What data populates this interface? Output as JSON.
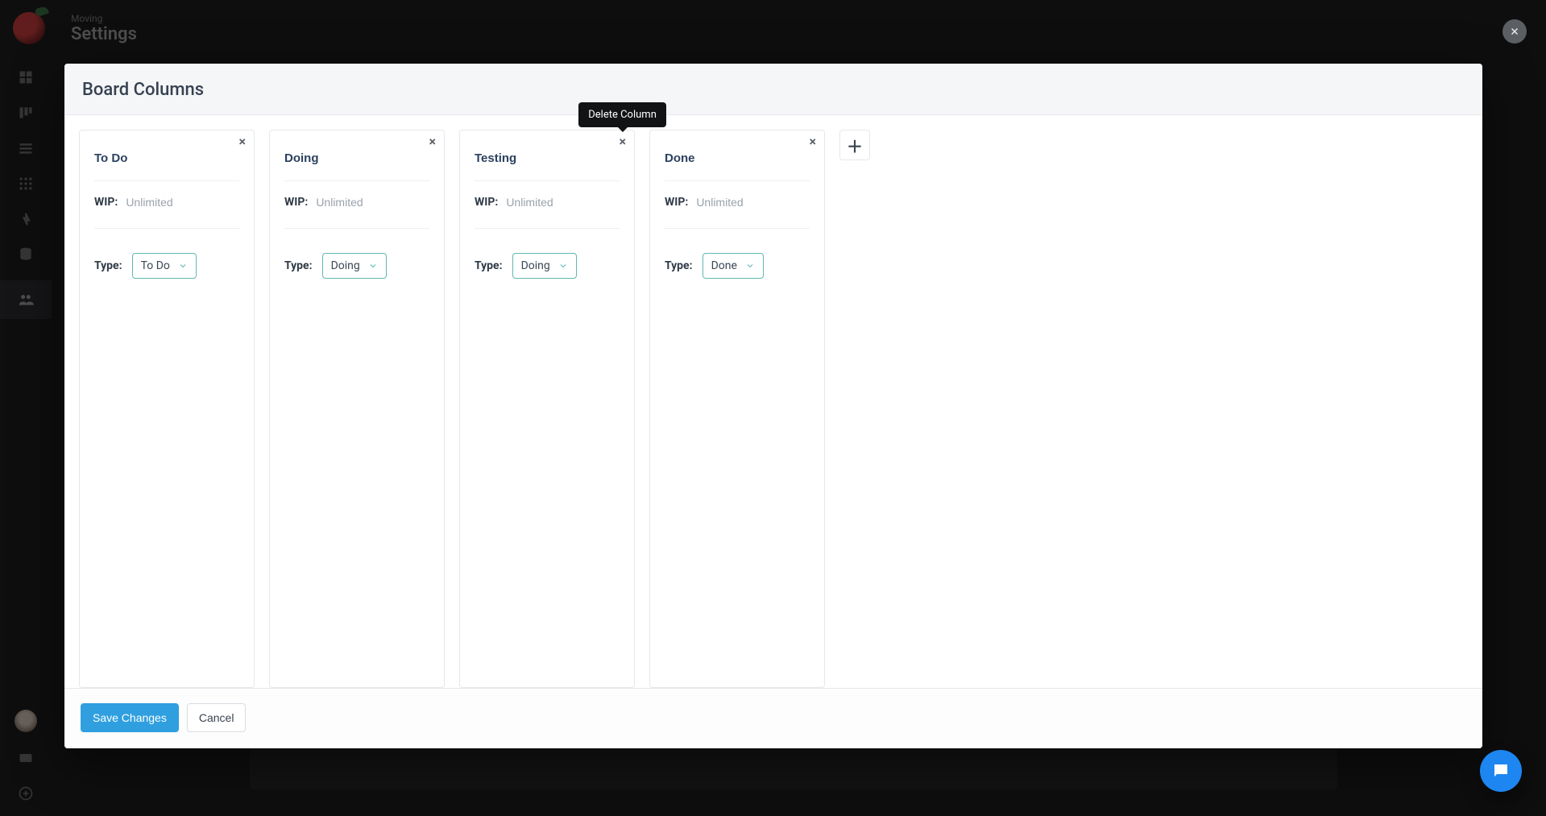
{
  "header": {
    "breadcrumb": "Moving",
    "title": "Settings"
  },
  "modal": {
    "title": "Board Columns",
    "save_label": "Save Changes",
    "cancel_label": "Cancel"
  },
  "labels": {
    "wip": "WIP:",
    "type": "Type:",
    "wip_placeholder": "Unlimited"
  },
  "tooltip": {
    "delete_column": "Delete Column"
  },
  "columns": [
    {
      "name": "To Do",
      "wip": "",
      "type": "To Do"
    },
    {
      "name": "Doing",
      "wip": "",
      "type": "Doing"
    },
    {
      "name": "Testing",
      "wip": "",
      "type": "Doing"
    },
    {
      "name": "Done",
      "wip": "",
      "type": "Done"
    }
  ]
}
